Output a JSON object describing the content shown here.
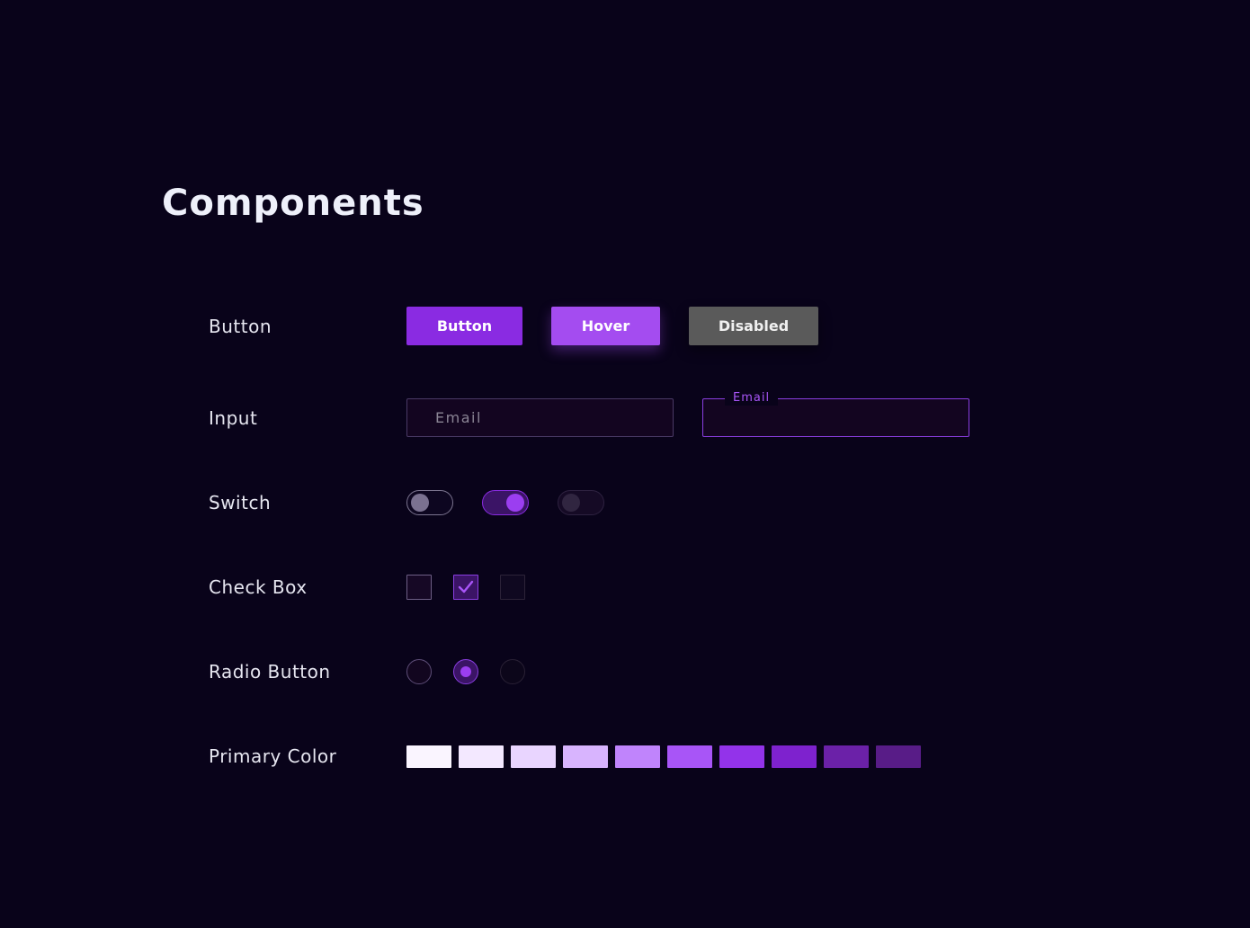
{
  "page": {
    "title": "Components"
  },
  "rows": {
    "button": "Button",
    "input": "Input",
    "switch": "Switch",
    "checkbox": "Check Box",
    "radio": "Radio Button",
    "primary_color": "Primary Color"
  },
  "buttons": {
    "default_label": "Button",
    "hover_label": "Hover",
    "disabled_label": "Disabled"
  },
  "inputs": {
    "default": {
      "placeholder": "Email",
      "value": ""
    },
    "focused": {
      "label": "Email",
      "value": ""
    }
  },
  "switches": {
    "off": {
      "state": "off"
    },
    "on": {
      "state": "on"
    },
    "disabled": {
      "state": "disabled"
    }
  },
  "checkboxes": {
    "off": {
      "checked": false
    },
    "on": {
      "checked": true,
      "icon": "check-icon"
    },
    "disabled": {
      "checked": false,
      "disabled": true
    }
  },
  "radios": {
    "off": {
      "selected": false
    },
    "on": {
      "selected": true
    },
    "disabled": {
      "selected": false,
      "disabled": true
    }
  },
  "colors": {
    "background": "#09031a",
    "accent": "#8a2be2",
    "hover": "#a44cf0",
    "disabled": "#5a5a5a",
    "primary_palette": [
      "#faf5ff",
      "#f3e8ff",
      "#e9d5ff",
      "#d8b4fe",
      "#c084fc",
      "#a855f7",
      "#9333ea",
      "#7e22ce",
      "#6b21a8",
      "#581c87"
    ]
  }
}
